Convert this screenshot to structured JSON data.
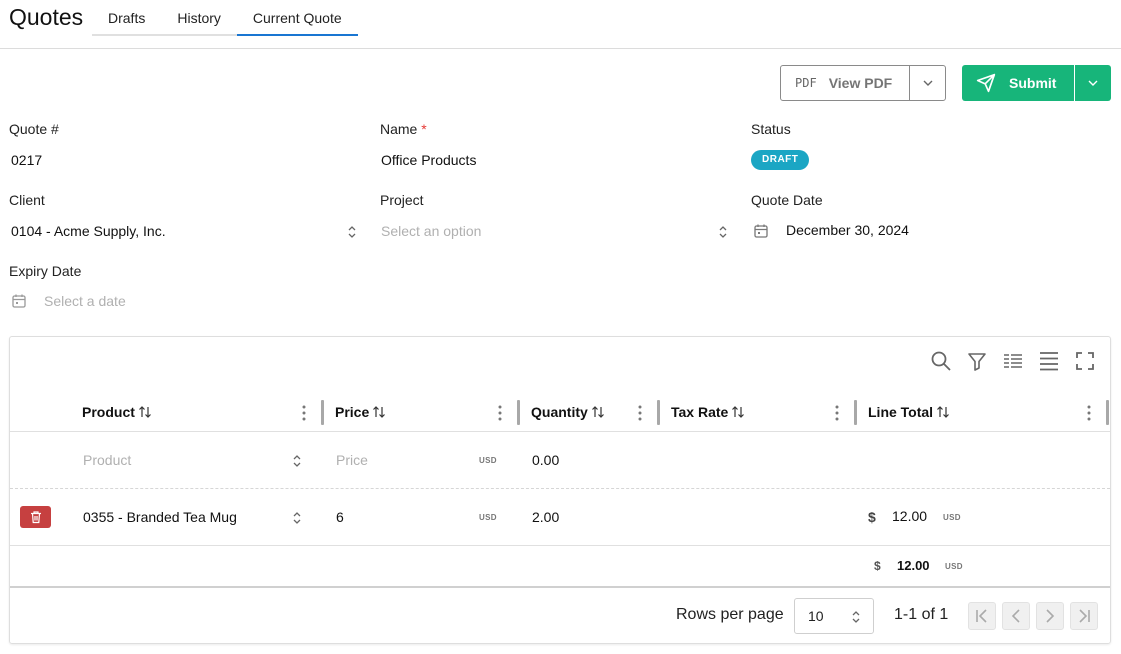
{
  "app": {
    "title": "Quotes"
  },
  "tabs": [
    {
      "label": "Drafts",
      "active": false
    },
    {
      "label": "History",
      "active": false
    },
    {
      "label": "Current Quote",
      "active": true
    }
  ],
  "actions": {
    "pdf_prefix": "PDF",
    "view_pdf_label": "View PDF",
    "submit_label": "Submit"
  },
  "form": {
    "quote_number": {
      "label": "Quote #",
      "value": "0217"
    },
    "name": {
      "label": "Name",
      "required_mark": "*",
      "value": "Office Products"
    },
    "status": {
      "label": "Status",
      "value": "DRAFT"
    },
    "client": {
      "label": "Client",
      "value": "0104 - Acme Supply, Inc."
    },
    "project": {
      "label": "Project",
      "placeholder": "Select an option"
    },
    "quote_date": {
      "label": "Quote Date",
      "value": "December 30, 2024"
    },
    "expiry_date": {
      "label": "Expiry Date",
      "placeholder": "Select a date"
    }
  },
  "table": {
    "toolbar_icons": [
      "search-icon",
      "filter-icon",
      "density-icon",
      "columns-icon",
      "fullscreen-icon"
    ],
    "columns": [
      "Product",
      "Price",
      "Quantity",
      "Tax Rate",
      "Line Total"
    ],
    "new_row": {
      "product_placeholder": "Product",
      "price_placeholder": "Price",
      "currency": "USD",
      "quantity": "0.00"
    },
    "rows": [
      {
        "product": "0355 - Branded Tea Mug",
        "price": "6",
        "currency": "USD",
        "quantity": "2.00",
        "tax_rate": "",
        "total_symbol": "$",
        "total": "12.00",
        "total_currency": "USD"
      }
    ],
    "summary": {
      "symbol": "$",
      "total": "12.00",
      "currency": "USD"
    },
    "footer": {
      "rows_per_page_label": "Rows per page",
      "rows_per_page": "10",
      "range": "1-1 of 1"
    }
  },
  "colors": {
    "accent": "#1976d2",
    "submit": "#17b57a",
    "status_badge": "#1ba6c4",
    "delete": "#c64040"
  }
}
